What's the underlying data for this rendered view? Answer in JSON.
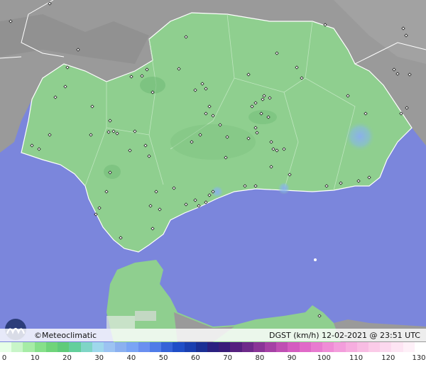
{
  "brand": {
    "name": "©Meteoclimatic"
  },
  "caption": {
    "variable": "DGST (km/h)",
    "date": "12-02-2021",
    "at": "@",
    "time": "23:51 UTC"
  },
  "legend": {
    "ticks": [
      "0",
      "10",
      "20",
      "30",
      "40",
      "50",
      "60",
      "70",
      "80",
      "90",
      "100",
      "110",
      "120",
      "130"
    ],
    "colors": [
      "#e6ffe6",
      "#c8f5c8",
      "#a6eca6",
      "#86e08a",
      "#6fd47a",
      "#5fcb7a",
      "#63cf9b",
      "#7fd5c6",
      "#9fd8ec",
      "#9cc3f2",
      "#8bb0f0",
      "#7aa4f5",
      "#6a8ff0",
      "#4f7ce8",
      "#3563d8",
      "#1f4ec7",
      "#1a3fb0",
      "#1b2f95",
      "#2a2080",
      "#3a1c7a",
      "#55207f",
      "#6e2a8a",
      "#8a3597",
      "#a541a5",
      "#bf4fb3",
      "#d45cc0",
      "#e06ac8",
      "#e87bd0",
      "#ef8cd6",
      "#f39ddc",
      "#f6addf",
      "#f8bce3",
      "#fbcbe8",
      "#fcd8ee",
      "#fde4f3",
      "#fef0f8",
      "#ffffff"
    ]
  },
  "map": {
    "land_color": "#8fcf8f",
    "highland_color": "#7fc482",
    "neighbor_color": "#9a9a9a",
    "sea_color": "#7b86dc",
    "gust_cell_color": "#8aaef0"
  }
}
